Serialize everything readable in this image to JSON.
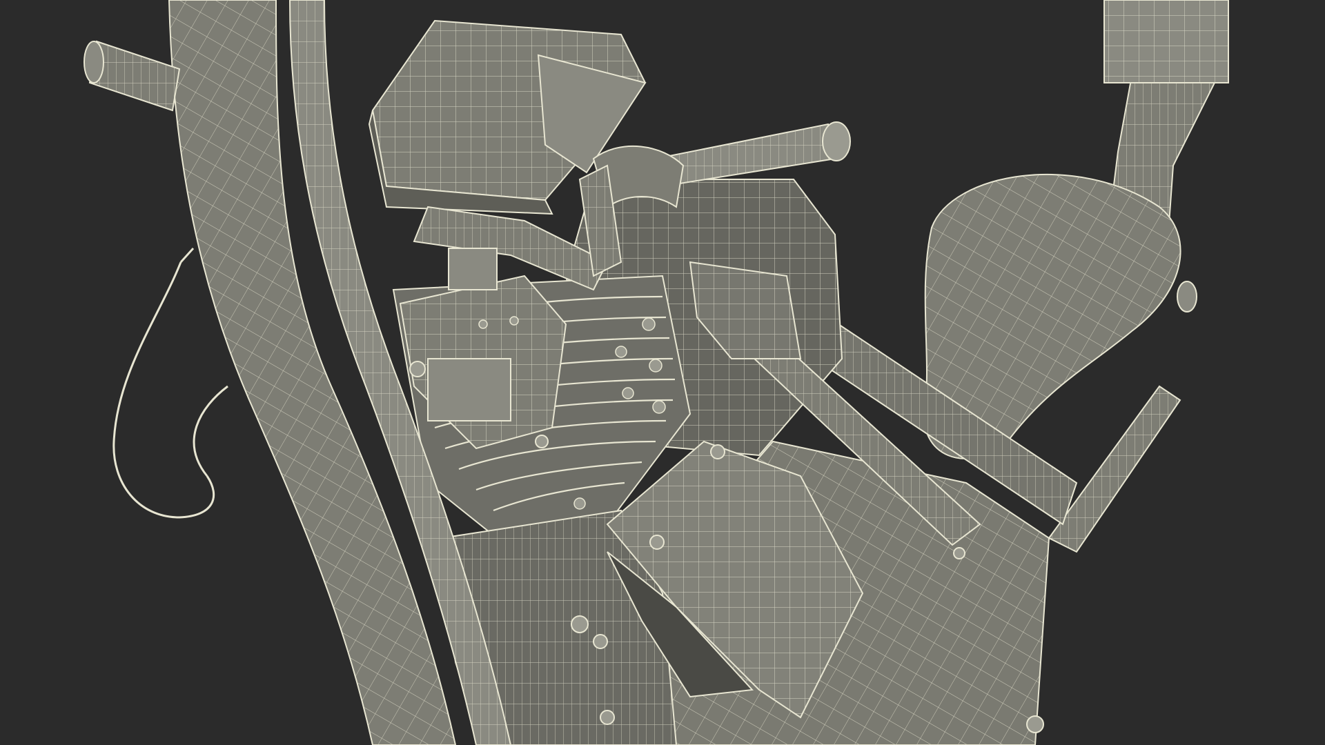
{
  "scene": {
    "subject": "",
    "render_style": "wireframe-over-shaded",
    "colors": {
      "background": "#2b2b2b",
      "surface": "#7d7d74",
      "surface_light": "#929289",
      "surface_dark": "#5e5e57",
      "shadow": "#3a3a36",
      "wire": "#e8e6d2"
    }
  }
}
